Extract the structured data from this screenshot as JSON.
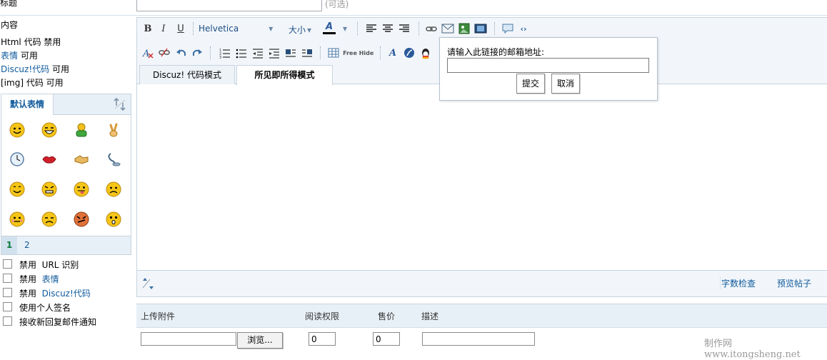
{
  "title_row": {
    "label": "标题",
    "hint": "(可选)"
  },
  "left": {
    "content_label": "内容",
    "status": [
      {
        "name": "Html 代码",
        "value": "禁用",
        "link": false
      },
      {
        "name": "表情",
        "value": "可用",
        "link": true
      },
      {
        "name": "Discuz!代码",
        "value": "可用",
        "link": true
      },
      {
        "name": "[img] 代码",
        "value": "可用",
        "link": false
      }
    ],
    "emote_tab": "默认表情",
    "pages": [
      "1",
      "2"
    ],
    "options": [
      {
        "prefix": "禁用",
        "text": "URL 识别",
        "link": false
      },
      {
        "prefix": "禁用",
        "text": "表情",
        "link": true
      },
      {
        "prefix": "禁用",
        "text": "Discuz!代码",
        "link": true
      },
      {
        "prefix": "",
        "text": "使用个人签名",
        "link": false
      },
      {
        "prefix": "",
        "text": "接收新回复邮件通知",
        "link": false
      }
    ]
  },
  "toolbar": {
    "bold": "B",
    "italic": "I",
    "underline": "U",
    "font": "Helvetica",
    "size": "大小",
    "font_color_letter": "A"
  },
  "tabs": {
    "code_mode": "Discuz! 代码模式",
    "wysiwyg_mode": "所见即所得模式"
  },
  "popup": {
    "label": "请输入此链接的邮箱地址:",
    "submit": "提交",
    "cancel": "取消"
  },
  "footer": {
    "word_count": "字数检查",
    "preview": "预览帖子"
  },
  "attach": {
    "headers": {
      "upload": "上传附件",
      "read_perm": "阅读权限",
      "price": "售价",
      "desc": "描述"
    },
    "browse": "浏览...",
    "read_perm_value": "0",
    "price_value": "0"
  },
  "watermark": "制作网 www.itongsheng.net"
}
